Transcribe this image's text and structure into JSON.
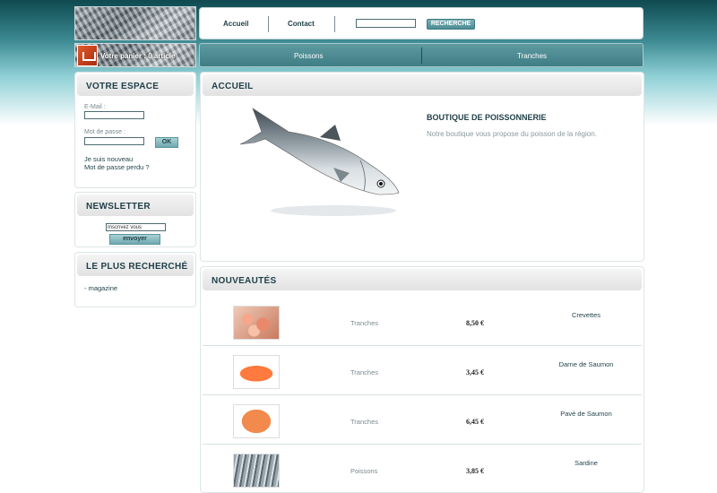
{
  "header": {
    "nav": [
      {
        "label": "Accueil"
      },
      {
        "label": "Contact"
      }
    ],
    "search_button": "RECHERCHE",
    "cart_text": "Votre panier : 0 article"
  },
  "category_nav": [
    {
      "label": "Poissons"
    },
    {
      "label": "Tranches"
    }
  ],
  "sidebar": {
    "espace": {
      "title": "VOTRE ESPACE",
      "email_label": "E-Mail :",
      "password_label": "Mot de passe :",
      "ok_button": "OK",
      "new_link": "Je suis nouveau",
      "lost_link": "Mot de passe perdu ?"
    },
    "newsletter": {
      "title": "NEWSLETTER",
      "input_value": "Inscrivez vous",
      "button": "envoyer"
    },
    "popular": {
      "title": "LE PLUS RECHERCHÉ",
      "items": [
        "- magazine"
      ]
    }
  },
  "main": {
    "accueil": {
      "title": "ACCUEIL",
      "shop_title": "BOUTIQUE DE POISSONNERIE",
      "shop_desc": "Notre boutique vous propose du poisson de la région."
    },
    "nouveautes": {
      "title": "NOUVEAUTÉS",
      "products": [
        {
          "category": "Tranches",
          "price": "8,50 €",
          "name": "Crevettes"
        },
        {
          "category": "Tranches",
          "price": "3,45 €",
          "name": "Darne de Saumon"
        },
        {
          "category": "Tranches",
          "price": "6,45 €",
          "name": "Pavé de Saumon"
        },
        {
          "category": "Poissons",
          "price": "3,85 €",
          "name": "Sardine"
        }
      ]
    }
  }
}
